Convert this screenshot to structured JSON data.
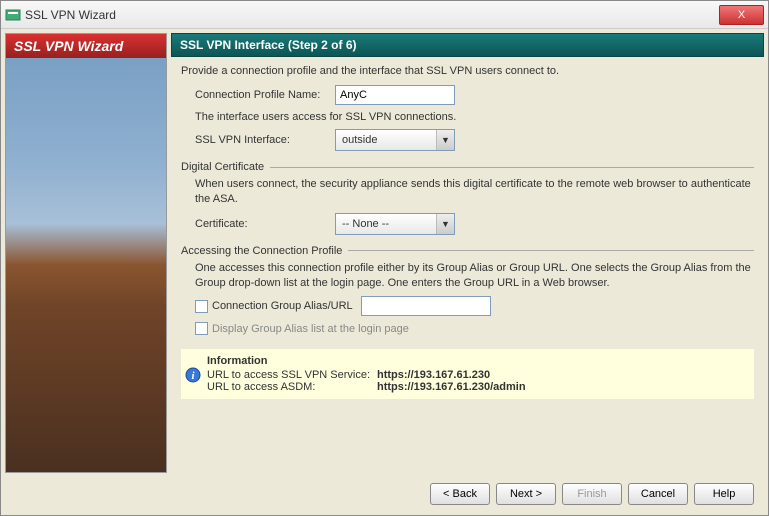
{
  "window": {
    "title": "SSL VPN Wizard",
    "close_label": "X"
  },
  "sidebar": {
    "header": "SSL VPN Wizard"
  },
  "header": {
    "title": "SSL VPN Interface  (Step 2 of 6)"
  },
  "intro": "Provide a connection profile and the interface that SSL VPN users connect to.",
  "profile": {
    "name_label": "Connection Profile Name:",
    "name_value": "AnyC",
    "interface_note": "The interface users access for SSL VPN connections.",
    "interface_label": "SSL VPN Interface:",
    "interface_value": "outside"
  },
  "digital_cert": {
    "legend": "Digital Certificate",
    "desc": "When users connect, the security appliance sends this digital certificate to the remote web browser to authenticate the ASA.",
    "cert_label": "Certificate:",
    "cert_value": "-- None --"
  },
  "accessing": {
    "legend": "Accessing the Connection Profile",
    "desc": "One accesses this connection profile either by its Group Alias or Group URL. One selects the Group Alias from the Group drop-down list at the login page. One enters the Group URL in a Web browser.",
    "alias_checkbox_label": "Connection Group Alias/URL",
    "alias_value": "",
    "display_checkbox_label": "Display Group Alias list at the login page"
  },
  "info": {
    "title": "Information",
    "line1_label": "URL to access SSL VPN Service:",
    "line1_value": "https://193.167.61.230",
    "line2_label": "URL to access ASDM:",
    "line2_value": "https://193.167.61.230/admin"
  },
  "buttons": {
    "back": "< Back",
    "next": "Next >",
    "finish": "Finish",
    "cancel": "Cancel",
    "help": "Help"
  }
}
